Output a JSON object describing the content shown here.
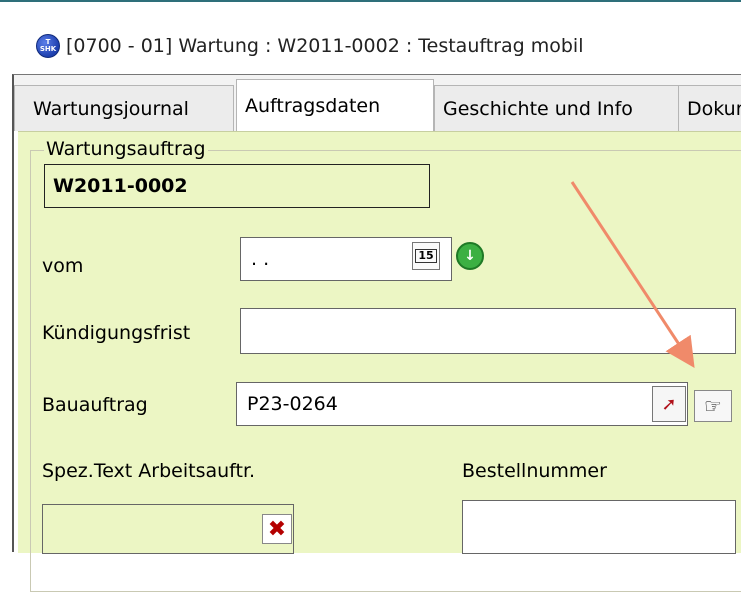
{
  "window": {
    "title": "[0700 - 01] Wartung : W2011-0002 : Testauftrag mobil",
    "icon_text_top": "T",
    "icon_text_bottom": "SHK"
  },
  "tabs": [
    {
      "label": "Wartungsjournal",
      "active": false
    },
    {
      "label": "Auftragsdaten",
      "active": true
    },
    {
      "label": "Geschichte und Info",
      "active": false
    },
    {
      "label": "Dokur",
      "active": false
    }
  ],
  "form": {
    "group_title": "Wartungsauftrag",
    "order_number": "W2011-0002",
    "vom_label": "vom",
    "vom_value": ". .",
    "calendar_day": "15",
    "kuendigungsfrist_label": "Kündigungsfrist",
    "kuendigungsfrist_value": "",
    "bauauftrag_label": "Bauauftrag",
    "bauauftrag_value": "P23-0264",
    "spez_text_label": "Spez.Text Arbeitsauftr.",
    "bestellnummer_label": "Bestellnummer",
    "bestellnummer_value": ""
  },
  "colors": {
    "panel_bg": "#ecf6c4",
    "arrow": "#f08a6a",
    "go_button": "#3cb043"
  },
  "icons": {
    "calendar": "calendar-icon",
    "go": "arrow-down-circle-icon",
    "pin": "pin-icon",
    "hand": "pointing-hand-icon",
    "clear": "x-icon"
  }
}
